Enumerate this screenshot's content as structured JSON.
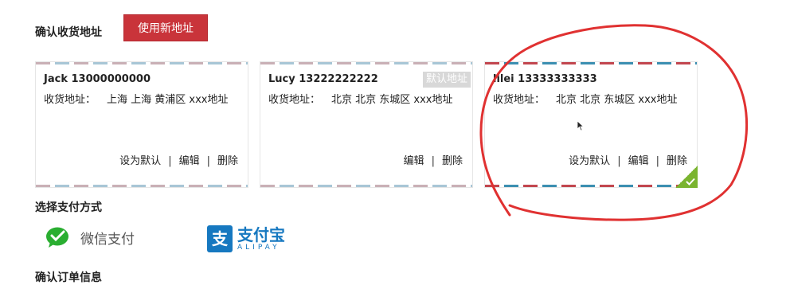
{
  "address_section": {
    "title": "确认收货地址",
    "new_address_button": "使用新地址"
  },
  "addresses": [
    {
      "name_phone": "Jack 13000000000",
      "address_label": "收货地址：",
      "address": "上海 上海 黄浦区 xxx地址",
      "actions": [
        "设为默认",
        "编辑",
        "删除"
      ],
      "is_default": false,
      "selected": false
    },
    {
      "name_phone": "Lucy 13222222222",
      "address_label": "收货地址：",
      "address": "北京 北京 东城区 xxx地址",
      "actions": [
        "编辑",
        "删除"
      ],
      "default_badge": "默认地址",
      "is_default": true,
      "selected": false
    },
    {
      "name_phone": "lilei 13333333333",
      "address_label": "收货地址：",
      "address": "北京 北京 东城区 xxx地址",
      "actions": [
        "设为默认",
        "编辑",
        "删除"
      ],
      "is_default": false,
      "selected": true
    }
  ],
  "action_separator": "|",
  "payment_section": {
    "title": "选择支付方式",
    "methods": [
      {
        "label": "微信支付",
        "icon": "wechat-pay-icon",
        "color": "#2aae31"
      },
      {
        "label": "支付宝",
        "sublabel": "ALIPAY",
        "icon": "alipay-icon",
        "color": "#1678c0"
      }
    ]
  },
  "order_section": {
    "title": "确认订单信息"
  },
  "colors": {
    "primary_button": "#c9343a",
    "selected_check": "#7ab42f",
    "annotation_red": "#e03131"
  }
}
